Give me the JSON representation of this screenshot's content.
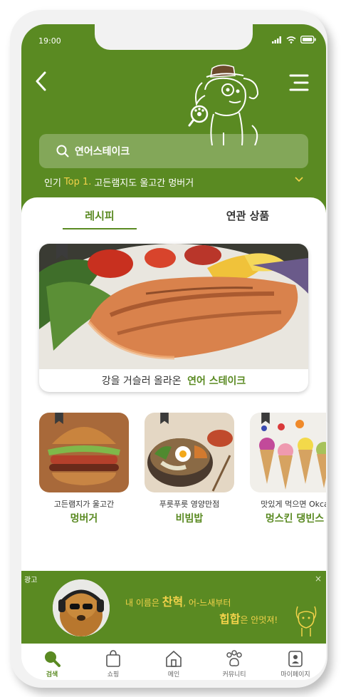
{
  "status": {
    "time": "19:00"
  },
  "header": {
    "search_value": "연어스테이크",
    "popular_prefix": "인기",
    "popular_rank": "Top 1.",
    "popular_text": "고든램지도 울고간 멍버거"
  },
  "tabs": [
    {
      "label": "레시피",
      "active": true
    },
    {
      "label": "연관 상품",
      "active": false
    }
  ],
  "hero": {
    "caption_prefix": "강을 거슬러 올라온",
    "caption_title": "연어 스테이크"
  },
  "cards": [
    {
      "subtitle": "고든램지가 울고간",
      "title": "멍버거"
    },
    {
      "subtitle": "푸릇푸릇 영양만점",
      "title": "비빔밥"
    },
    {
      "subtitle": "맛있게 먹으면 Okca",
      "title": "멍스킨 댕빈스"
    }
  ],
  "ad": {
    "tag": "광고",
    "close": "×",
    "line1_a": "내 이름은 ",
    "line1_name": "찬혁",
    "line1_b": ", 어-느새부터",
    "line2_hiphop": "힙합",
    "line2_b": "은 안멋져!"
  },
  "nav": [
    {
      "label": "검색",
      "icon": "search-icon",
      "active": true
    },
    {
      "label": "쇼핑",
      "icon": "shopping-bag-icon",
      "active": false
    },
    {
      "label": "메인",
      "icon": "home-icon",
      "active": false
    },
    {
      "label": "커뮤니티",
      "icon": "paw-icon",
      "active": false
    },
    {
      "label": "마이페이지",
      "icon": "profile-icon",
      "active": false
    }
  ],
  "colors": {
    "brand_green": "#5a8a22",
    "accent_yellow": "#f2d24a"
  }
}
